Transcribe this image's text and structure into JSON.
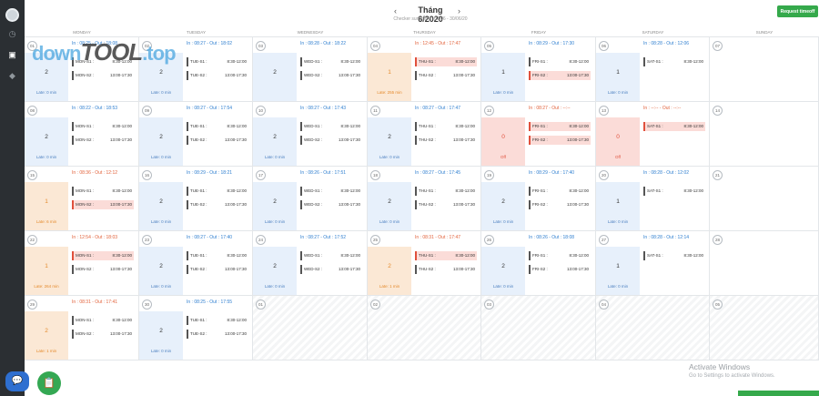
{
  "sidebar": {
    "icons": [
      "user-avatar",
      "clock-icon",
      "calendar-icon",
      "bell-icon"
    ]
  },
  "header": {
    "prev": "‹",
    "next": "›",
    "title": "Tháng 6/2020",
    "subtitle": "Checker summary : 01/06 - 30/06/20",
    "request_button": "Request timeoff"
  },
  "weekdays": [
    "MONDAY",
    "TUESDAY",
    "WEDNESDAY",
    "THURSDAY",
    "FRIDAY",
    "SATURDAY",
    "SUNDAY"
  ],
  "watermark": {
    "pre": "down",
    "mid": "TOOL",
    "post": ".top"
  },
  "weeks": [
    [
      {
        "day": "01",
        "inout": "In : 08:25 - Out : 18:08",
        "warn": false,
        "count": "2",
        "late": "Late: 0 min",
        "tone": "blue",
        "shifts": [
          {
            "name": "MON-S1 :",
            "time": "8:30-12:00",
            "late": false
          },
          {
            "name": "MON-S2 :",
            "time": "13:00-17:30",
            "late": false
          }
        ]
      },
      {
        "day": "02",
        "inout": "In : 08:27 - Out : 18:02",
        "warn": false,
        "count": "2",
        "late": "Late: 0 min",
        "tone": "blue",
        "shifts": [
          {
            "name": "TUE-S1 :",
            "time": "8:30-12:00",
            "late": false
          },
          {
            "name": "TUE-S2 :",
            "time": "13:00-17:30",
            "late": false
          }
        ]
      },
      {
        "day": "03",
        "inout": "In : 08:28 - Out : 18:22",
        "warn": false,
        "count": "2",
        "late": "",
        "tone": "blue",
        "shifts": [
          {
            "name": "WED-S1 :",
            "time": "8:30-12:00",
            "late": false
          },
          {
            "name": "WED-S2 :",
            "time": "13:00-17:30",
            "late": false
          }
        ]
      },
      {
        "day": "04",
        "inout": "In : 12:45 - Out : 17:47",
        "warn": true,
        "count": "1",
        "late": "Late: 255 min",
        "tone": "orange",
        "shifts": [
          {
            "name": "THU-S1 :",
            "time": "8:30-12:00",
            "late": true
          },
          {
            "name": "THU-S2 :",
            "time": "13:00-17:30",
            "late": false
          }
        ]
      },
      {
        "day": "05",
        "inout": "In : 08:29 - Out : 17:30",
        "warn": false,
        "count": "1",
        "late": "Late: 0 min",
        "tone": "blue",
        "shifts": [
          {
            "name": "FRI-S1 :",
            "time": "8:30-12:00",
            "late": false
          },
          {
            "name": "FRI-S2 :",
            "time": "13:00-17:30",
            "late": true
          }
        ]
      },
      {
        "day": "06",
        "inout": "In : 08:28 - Out : 12:06",
        "warn": false,
        "count": "1",
        "late": "Late: 0 min",
        "tone": "blue",
        "shifts": [
          {
            "name": "SAT-S1 :",
            "time": "8:30-12:00",
            "late": false
          }
        ]
      },
      {
        "day": "07",
        "inout": "",
        "warn": false,
        "count": "",
        "late": "",
        "tone": "none",
        "shifts": []
      }
    ],
    [
      {
        "day": "08",
        "inout": "In : 08:22 - Out : 18:53",
        "warn": false,
        "count": "2",
        "late": "Late: 0 min",
        "tone": "blue",
        "shifts": [
          {
            "name": "MON-S1 :",
            "time": "8:30-12:00",
            "late": false
          },
          {
            "name": "MON-S2 :",
            "time": "13:00-17:30",
            "late": false
          }
        ]
      },
      {
        "day": "09",
        "inout": "In : 08:27 - Out : 17:54",
        "warn": false,
        "count": "2",
        "late": "Late: 0 min",
        "tone": "blue",
        "shifts": [
          {
            "name": "TUE-S1 :",
            "time": "8:30-12:00",
            "late": false
          },
          {
            "name": "TUE-S2 :",
            "time": "13:00-17:30",
            "late": false
          }
        ]
      },
      {
        "day": "10",
        "inout": "In : 08:27 - Out : 17:43",
        "warn": false,
        "count": "2",
        "late": "Late: 0 min",
        "tone": "blue",
        "shifts": [
          {
            "name": "WED-S1 :",
            "time": "8:30-12:00",
            "late": false
          },
          {
            "name": "WED-S2 :",
            "time": "13:00-17:30",
            "late": false
          }
        ]
      },
      {
        "day": "11",
        "inout": "In : 08:27 - Out : 17:47",
        "warn": false,
        "count": "2",
        "late": "Late: 0 min",
        "tone": "blue",
        "shifts": [
          {
            "name": "THU-S1 :",
            "time": "8:30-12:00",
            "late": false
          },
          {
            "name": "THU-S2 :",
            "time": "13:00-17:30",
            "late": false
          }
        ]
      },
      {
        "day": "12",
        "inout": "In : 08:27 - Out : --:--",
        "warn": true,
        "count": "0",
        "late": "Off",
        "tone": "red",
        "shifts": [
          {
            "name": "FRI-S1 :",
            "time": "8:30-12:00",
            "late": true
          },
          {
            "name": "FRI-S2 :",
            "time": "13:00-17:30",
            "late": true
          }
        ]
      },
      {
        "day": "13",
        "inout": "In : --:-- - Out : --:--",
        "warn": true,
        "count": "0",
        "late": "Off",
        "tone": "red",
        "shifts": [
          {
            "name": "SAT-S1 :",
            "time": "8:30-12:00",
            "late": true
          }
        ]
      },
      {
        "day": "14",
        "inout": "",
        "warn": false,
        "count": "",
        "late": "",
        "tone": "none",
        "shifts": []
      }
    ],
    [
      {
        "day": "15",
        "inout": "In : 08:36 - Out : 12:12",
        "warn": true,
        "count": "1",
        "late": "Late: 6 min",
        "tone": "orange",
        "shifts": [
          {
            "name": "MON-S1 :",
            "time": "8:30-12:00",
            "late": false
          },
          {
            "name": "MON-S2 :",
            "time": "13:00-17:30",
            "late": true
          }
        ]
      },
      {
        "day": "16",
        "inout": "In : 08:29 - Out : 18:21",
        "warn": false,
        "count": "2",
        "late": "Late: 0 min",
        "tone": "blue",
        "shifts": [
          {
            "name": "TUE-S1 :",
            "time": "8:30-12:00",
            "late": false
          },
          {
            "name": "TUE-S2 :",
            "time": "13:00-17:30",
            "late": false
          }
        ]
      },
      {
        "day": "17",
        "inout": "In : 08:26 - Out : 17:51",
        "warn": false,
        "count": "2",
        "late": "Late: 0 min",
        "tone": "blue",
        "shifts": [
          {
            "name": "WED-S1 :",
            "time": "8:30-12:00",
            "late": false
          },
          {
            "name": "WED-S2 :",
            "time": "13:00-17:30",
            "late": false
          }
        ]
      },
      {
        "day": "18",
        "inout": "In : 08:27 - Out : 17:45",
        "warn": false,
        "count": "2",
        "late": "Late: 0 min",
        "tone": "blue",
        "shifts": [
          {
            "name": "THU-S1 :",
            "time": "8:30-12:00",
            "late": false
          },
          {
            "name": "THU-S2 :",
            "time": "13:00-17:30",
            "late": false
          }
        ]
      },
      {
        "day": "19",
        "inout": "In : 08:29 - Out : 17:40",
        "warn": false,
        "count": "2",
        "late": "Late: 0 min",
        "tone": "blue",
        "shifts": [
          {
            "name": "FRI-S1 :",
            "time": "8:30-12:00",
            "late": false
          },
          {
            "name": "FRI-S2 :",
            "time": "13:00-17:30",
            "late": false
          }
        ]
      },
      {
        "day": "20",
        "inout": "In : 08:28 - Out : 12:02",
        "warn": false,
        "count": "1",
        "late": "Late: 0 min",
        "tone": "blue",
        "shifts": [
          {
            "name": "SAT-S1 :",
            "time": "8:30-12:00",
            "late": false
          }
        ]
      },
      {
        "day": "21",
        "inout": "",
        "warn": false,
        "count": "",
        "late": "",
        "tone": "none",
        "shifts": []
      }
    ],
    [
      {
        "day": "22",
        "inout": "In : 12:54 - Out : 18:03",
        "warn": true,
        "count": "1",
        "late": "Late: 264 min",
        "tone": "orange",
        "shifts": [
          {
            "name": "MON-S1 :",
            "time": "8:30-12:00",
            "late": true
          },
          {
            "name": "MON-S2 :",
            "time": "13:00-17:30",
            "late": false
          }
        ]
      },
      {
        "day": "23",
        "inout": "In : 08:27 - Out : 17:40",
        "warn": false,
        "count": "2",
        "late": "Late: 0 min",
        "tone": "blue",
        "shifts": [
          {
            "name": "TUE-S1 :",
            "time": "8:30-12:00",
            "late": false
          },
          {
            "name": "TUE-S2 :",
            "time": "13:00-17:30",
            "late": false
          }
        ]
      },
      {
        "day": "24",
        "inout": "In : 08:27 - Out : 17:52",
        "warn": false,
        "count": "2",
        "late": "Late: 0 min",
        "tone": "blue",
        "shifts": [
          {
            "name": "WED-S1 :",
            "time": "8:30-12:00",
            "late": false
          },
          {
            "name": "WED-S2 :",
            "time": "13:00-17:30",
            "late": false
          }
        ]
      },
      {
        "day": "25",
        "inout": "In : 08:31 - Out : 17:47",
        "warn": true,
        "count": "2",
        "late": "Late: 1 min",
        "tone": "orange",
        "shifts": [
          {
            "name": "THU-S1 :",
            "time": "8:30-12:00",
            "late": true
          },
          {
            "name": "THU-S2 :",
            "time": "13:00-17:30",
            "late": false
          }
        ]
      },
      {
        "day": "26",
        "inout": "In : 08:26 - Out : 18:08",
        "warn": false,
        "count": "2",
        "late": "Late: 0 min",
        "tone": "blue",
        "shifts": [
          {
            "name": "FRI-S1 :",
            "time": "8:30-12:00",
            "late": false
          },
          {
            "name": "FRI-S2 :",
            "time": "13:00-17:30",
            "late": false
          }
        ]
      },
      {
        "day": "27",
        "inout": "In : 08:28 - Out : 12:14",
        "warn": false,
        "count": "1",
        "late": "Late: 0 min",
        "tone": "blue",
        "shifts": [
          {
            "name": "SAT-S1 :",
            "time": "8:30-12:00",
            "late": false
          }
        ]
      },
      {
        "day": "28",
        "inout": "",
        "warn": false,
        "count": "",
        "late": "",
        "tone": "none",
        "shifts": []
      }
    ],
    [
      {
        "day": "29",
        "inout": "In : 08:31 - Out : 17:41",
        "warn": true,
        "count": "2",
        "late": "Late: 1 min",
        "tone": "orange",
        "shifts": [
          {
            "name": "MON-S1 :",
            "time": "8:30-12:00",
            "late": false
          },
          {
            "name": "MON-S2 :",
            "time": "13:00-17:30",
            "late": false
          }
        ]
      },
      {
        "day": "30",
        "inout": "In : 08:25 - Out : 17:55",
        "warn": false,
        "count": "2",
        "late": "Late: 0 min",
        "tone": "blue",
        "shifts": [
          {
            "name": "TUE-S1 :",
            "time": "8:30-12:00",
            "late": false
          },
          {
            "name": "TUE-S2 :",
            "time": "13:00-17:30",
            "late": false
          }
        ]
      },
      {
        "day": "01",
        "inout": "",
        "warn": false,
        "count": "",
        "late": "",
        "tone": "gray",
        "shifts": []
      },
      {
        "day": "02",
        "inout": "",
        "warn": false,
        "count": "",
        "late": "",
        "tone": "gray",
        "shifts": []
      },
      {
        "day": "03",
        "inout": "",
        "warn": false,
        "count": "",
        "late": "",
        "tone": "gray",
        "shifts": []
      },
      {
        "day": "04",
        "inout": "",
        "warn": false,
        "count": "",
        "late": "",
        "tone": "gray",
        "shifts": []
      },
      {
        "day": "05",
        "inout": "",
        "warn": false,
        "count": "",
        "late": "",
        "tone": "gray",
        "shifts": []
      }
    ]
  ],
  "windows": {
    "activate": "Activate Windows",
    "goto": "Go to Settings to activate Windows."
  },
  "fab": {
    "chat": "💬",
    "clipboard": "📋"
  }
}
